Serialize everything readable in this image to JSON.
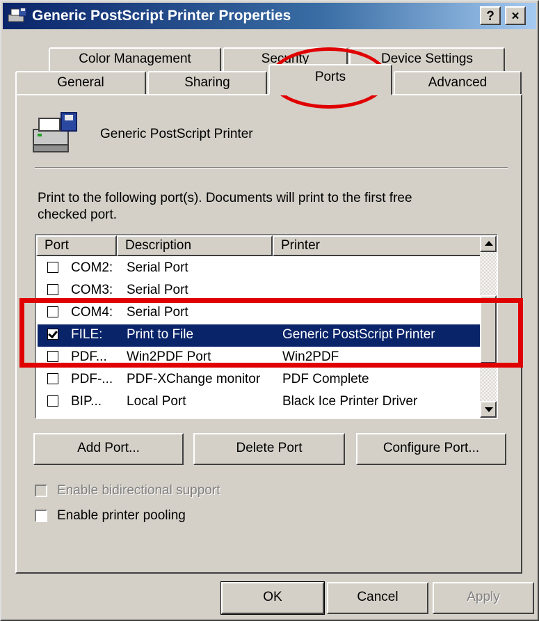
{
  "window": {
    "title": "Generic PostScript Printer Properties",
    "help_btn": "?",
    "close_btn": "×"
  },
  "tabs_row1": [
    "Color Management",
    "Security",
    "Device Settings"
  ],
  "tabs_row2": [
    "General",
    "Sharing",
    "Ports",
    "Advanced"
  ],
  "active_tab": "Ports",
  "printer_name": "Generic PostScript Printer",
  "instructions": {
    "line1": "Print to the following port(s). Documents will print to the first free",
    "line2": "checked port."
  },
  "port_list": {
    "columns": [
      "Port",
      "Description",
      "Printer"
    ],
    "rows": [
      {
        "port": "COM2:",
        "description": "Serial Port",
        "printer": "",
        "checked": false,
        "selected": false
      },
      {
        "port": "COM3:",
        "description": "Serial Port",
        "printer": "",
        "checked": false,
        "selected": false
      },
      {
        "port": "COM4:",
        "description": "Serial Port",
        "printer": "",
        "checked": false,
        "selected": false
      },
      {
        "port": "FILE:",
        "description": "Print to File",
        "printer": "Generic PostScript Printer",
        "checked": true,
        "selected": true
      },
      {
        "port": "PDF...",
        "description": "Win2PDF Port",
        "printer": "Win2PDF",
        "checked": false,
        "selected": false
      },
      {
        "port": "PDF-...",
        "description": "PDF-XChange monitor",
        "printer": "PDF Complete",
        "checked": false,
        "selected": false
      },
      {
        "port": "BIP...",
        "description": "Local Port",
        "printer": "Black Ice Printer Driver",
        "checked": false,
        "selected": false
      }
    ]
  },
  "buttons": {
    "add_port": "Add Port...",
    "delete_port": "Delete Port",
    "configure_port": "Configure Port...",
    "ok": "OK",
    "cancel": "Cancel",
    "apply": "Apply"
  },
  "options": {
    "bidirectional": "Enable bidirectional support",
    "pooling": "Enable printer pooling"
  },
  "colors": {
    "annotation": "#e00000",
    "selection": "#0a246a",
    "dialog_bg": "#d4d0c8"
  }
}
